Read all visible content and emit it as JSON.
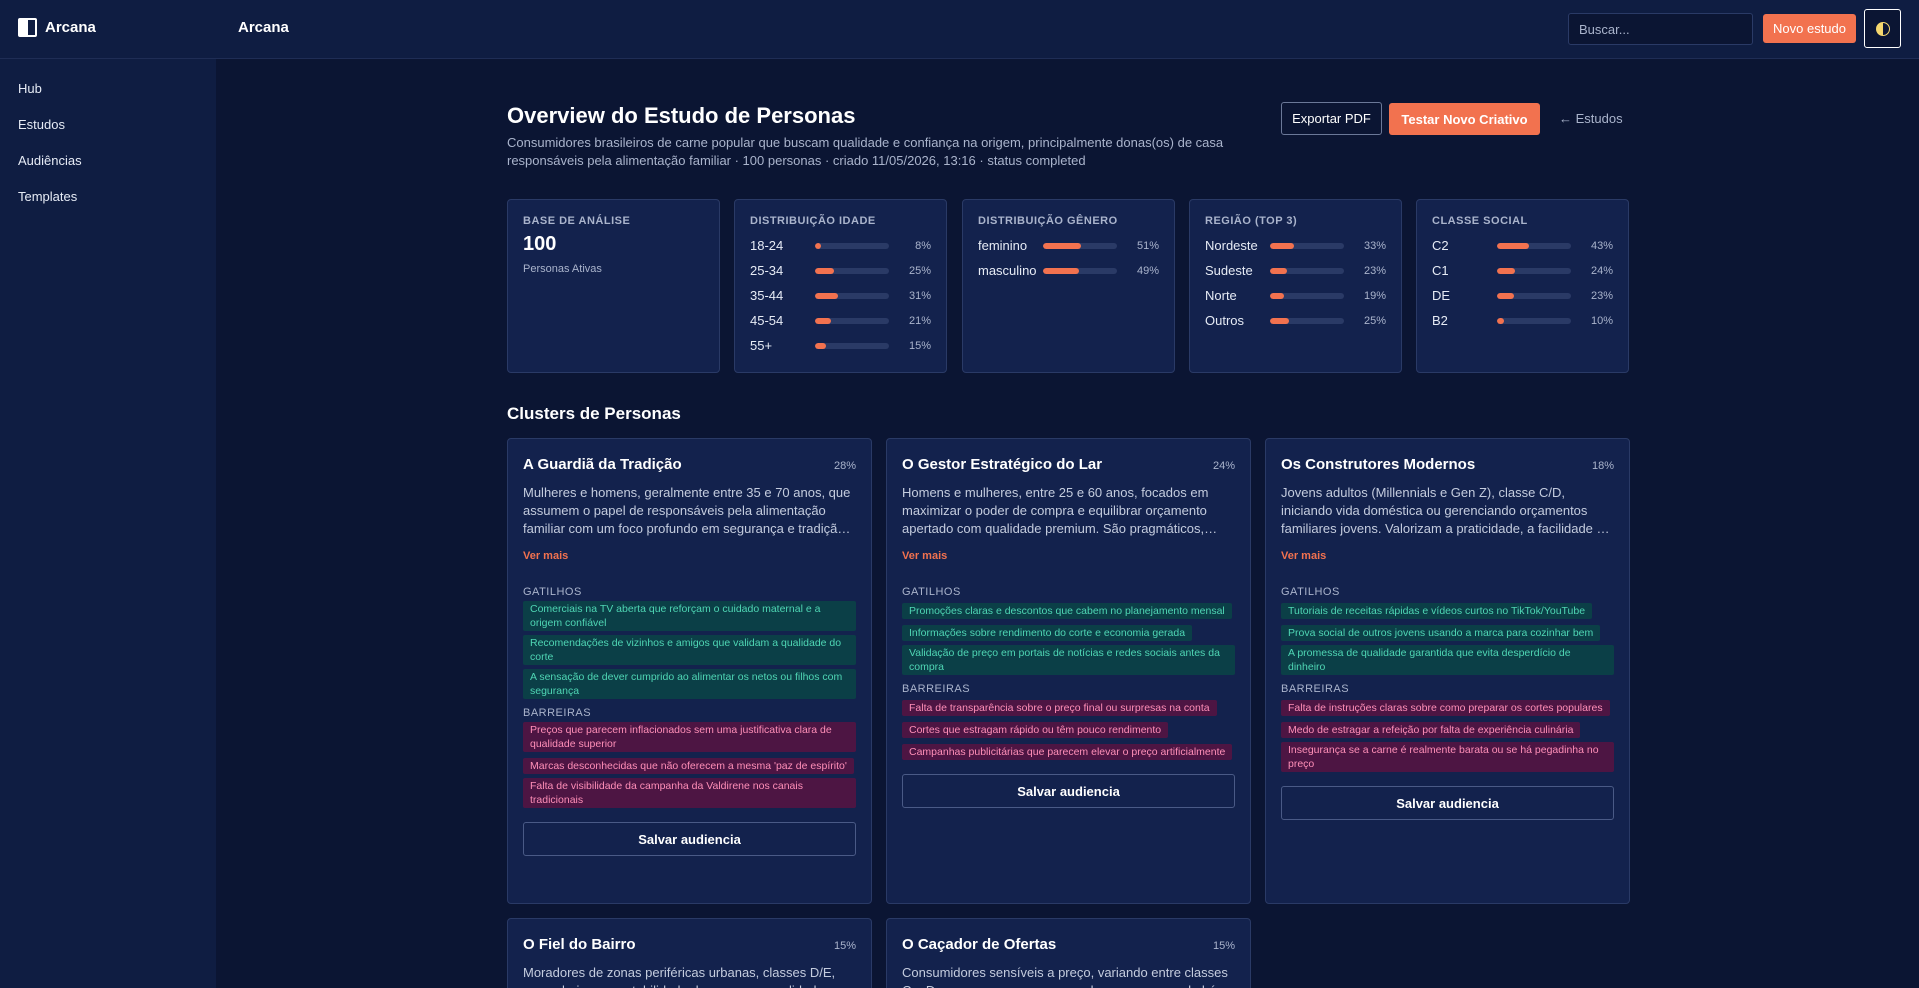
{
  "app": {
    "name": "Arcana",
    "header_title": "Arcana"
  },
  "topbar": {
    "search_placeholder": "Buscar...",
    "new_study_label": "Novo estudo"
  },
  "sidebar": {
    "items": [
      {
        "label": "Hub"
      },
      {
        "label": "Estudos"
      },
      {
        "label": "Audiências"
      },
      {
        "label": "Templates"
      }
    ]
  },
  "page": {
    "title": "Overview do Estudo de Personas",
    "description": "Consumidores brasileiros de carne popular que buscam qualidade e confiança na origem, principalmente donas(os) de casa responsáveis pela alimentação familiar · 100 personas · criado 11/05/2026, 13:16 · status completed",
    "export_label": "Exportar PDF",
    "test_label": "Testar Novo Criativo",
    "back_label": "← Estudos"
  },
  "accent_color": "#f2724f",
  "stats": {
    "base": {
      "label": "BASE DE ANÁLISE",
      "value": "100",
      "sub": "Personas Ativas"
    },
    "age": {
      "label": "DISTRIBUIÇÃO IDADE",
      "rows": [
        {
          "name": "18-24",
          "pct": "8%",
          "value": 8
        },
        {
          "name": "25-34",
          "pct": "25%",
          "value": 25
        },
        {
          "name": "35-44",
          "pct": "31%",
          "value": 31
        },
        {
          "name": "45-54",
          "pct": "21%",
          "value": 21
        },
        {
          "name": "55+",
          "pct": "15%",
          "value": 15
        }
      ]
    },
    "gender": {
      "label": "DISTRIBUIÇÃO GÊNERO",
      "rows": [
        {
          "name": "feminino",
          "pct": "51%",
          "value": 51
        },
        {
          "name": "masculino",
          "pct": "49%",
          "value": 49
        }
      ]
    },
    "region": {
      "label": "REGIÃO (TOP 3)",
      "rows": [
        {
          "name": "Nordeste",
          "pct": "33%",
          "value": 33
        },
        {
          "name": "Sudeste",
          "pct": "23%",
          "value": 23
        },
        {
          "name": "Norte",
          "pct": "19%",
          "value": 19
        },
        {
          "name": "Outros",
          "pct": "25%",
          "value": 25
        }
      ]
    },
    "social": {
      "label": "CLASSE SOCIAL",
      "rows": [
        {
          "name": "C2",
          "pct": "43%",
          "value": 43
        },
        {
          "name": "C1",
          "pct": "24%",
          "value": 24
        },
        {
          "name": "DE",
          "pct": "23%",
          "value": 23
        },
        {
          "name": "B2",
          "pct": "10%",
          "value": 10
        }
      ]
    }
  },
  "clusters_title": "Clusters de Personas",
  "cluster_labels": {
    "triggers": "GATILHOS",
    "barriers": "BARREIRAS",
    "more": "Ver mais",
    "save": "Salvar audiencia"
  },
  "clusters": [
    {
      "name": "A Guardiã da Tradição",
      "pct": "28%",
      "desc": "Mulheres e homens, geralmente entre 35 e 70 anos, que assumem o papel de responsáveis pela alimentação familiar com um foco profundo em segurança e tradição. Valorizam marcas de confiança.",
      "triggers": [
        "Comerciais na TV aberta que reforçam o cuidado maternal e a origem confiável",
        "Recomendações de vizinhos e amigos que validam a qualidade do corte",
        "A sensação de dever cumprido ao alimentar os netos ou filhos com segurança"
      ],
      "barriers": [
        "Preços que parecem inflacionados sem uma justificativa clara de qualidade superior",
        "Marcas desconhecidas que não oferecem a mesma 'paz de espírito'",
        "Falta de visibilidade da campanha da Valdirene nos canais tradicionais"
      ]
    },
    {
      "name": "O Gestor Estratégico do Lar",
      "pct": "24%",
      "desc": "Homens e mulheres, entre 25 e 60 anos, focados em maximizar o poder de compra e equilibrar orçamento apertado com qualidade premium. São pragmáticos, comparam preços.",
      "triggers": [
        "Promoções claras e descontos que cabem no planejamento mensal",
        "Informações sobre rendimento do corte e economia gerada",
        "Validação de preço em portais de notícias e redes sociais antes da compra"
      ],
      "barriers": [
        "Falta de transparência sobre o preço final ou surpresas na conta",
        "Cortes que estragam rápido ou têm pouco rendimento",
        "Campanhas publicitárias que parecem elevar o preço artificialmente"
      ]
    },
    {
      "name": "Os Construtores Modernos",
      "pct": "18%",
      "desc": "Jovens adultos (Millennials e Gen Z), classe C/D, iniciando vida doméstica ou gerenciando orçamentos familiares jovens. Valorizam a praticidade, a facilidade de preparo e o conteúdo digital.",
      "triggers": [
        "Tutoriais de receitas rápidas e vídeos curtos no TikTok/YouTube",
        "Prova social de outros jovens usando a marca para cozinhar bem",
        "A promessa de qualidade garantida que evita desperdício de dinheiro"
      ],
      "barriers": [
        "Falta de instruções claras sobre como preparar os cortes populares",
        "Medo de estragar a refeição por falta de experiência culinária",
        "Insegurança se a carne é realmente barata ou se há pegadinha no preço"
      ]
    },
    {
      "name": "O Fiel do Bairro",
      "pct": "15%",
      "desc": "Moradores de zonas periféricas urbanas, classes D/E, que valorizam a estabilidade de preço e a qualidade consistente.",
      "triggers": [],
      "barriers": []
    },
    {
      "name": "O Caçador de Ofertas",
      "pct": "15%",
      "desc": "Consumidores sensíveis a preço, variando entre classes C e D, que compram carne popular apenas quando há promoção.",
      "triggers": [],
      "barriers": []
    }
  ]
}
